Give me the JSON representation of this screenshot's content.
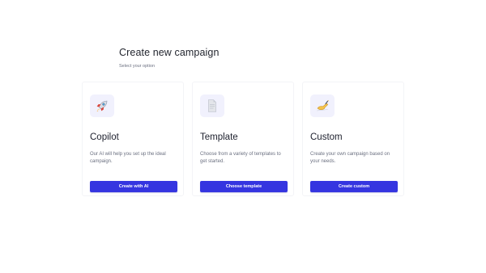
{
  "header": {
    "title": "Create new campaign",
    "subtitle": "Select your option"
  },
  "cards": [
    {
      "icon": "rocket-icon",
      "title": "Copilot",
      "description": "Our AI will help you set up the ideal campaign.",
      "button_label": "Create with AI"
    },
    {
      "icon": "document-icon",
      "title": "Template",
      "description": "Choose from a variety of templates to get started.",
      "button_label": "Choose template"
    },
    {
      "icon": "writing-hand-icon",
      "title": "Custom",
      "description": "Create your own campaign based on your needs.",
      "button_label": "Create custom"
    }
  ],
  "colors": {
    "accent": "#3535e0",
    "icon_bg": "#f1f1fd",
    "text_muted": "#6b7080"
  }
}
